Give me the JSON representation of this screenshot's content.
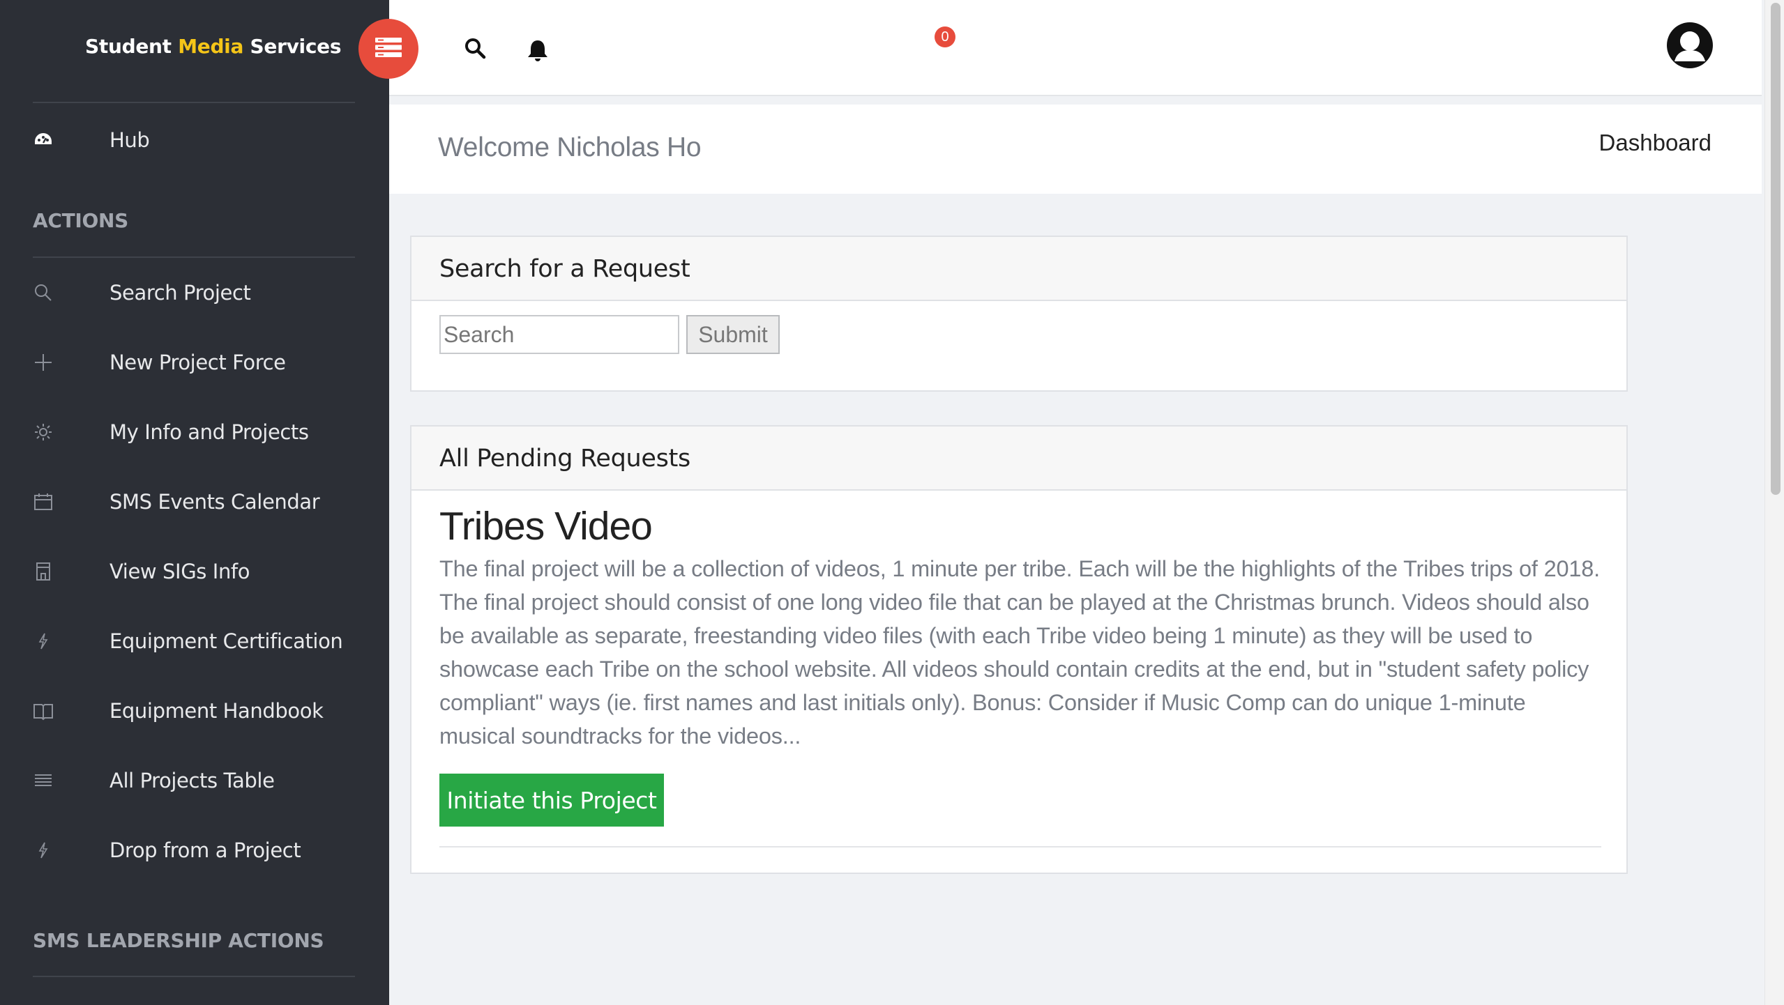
{
  "brand": {
    "part1": "Student ",
    "part2": "Media",
    "part3": " Services"
  },
  "sidebar": {
    "hub": {
      "label": "Hub",
      "icon": "dashboard-icon"
    },
    "actions_heading": "ACTIONS",
    "items": [
      {
        "label": "Search Project",
        "icon": "search-icon"
      },
      {
        "label": "New Project Force",
        "icon": "plus-icon"
      },
      {
        "label": "My Info and Projects",
        "icon": "sun-icon"
      },
      {
        "label": "SMS Events Calendar",
        "icon": "calendar-icon"
      },
      {
        "label": "View SIGs Info",
        "icon": "building-icon"
      },
      {
        "label": "Equipment Certification",
        "icon": "bolt-icon"
      },
      {
        "label": "Equipment Handbook",
        "icon": "book-icon"
      },
      {
        "label": "All Projects Table",
        "icon": "list-icon"
      },
      {
        "label": "Drop from a Project",
        "icon": "bolt-icon"
      }
    ],
    "leadership_heading": "SMS LEADERSHIP ACTIONS"
  },
  "topbar": {
    "notification_count": "0"
  },
  "header": {
    "welcome": "Welcome Nicholas Ho",
    "breadcrumb": "Dashboard"
  },
  "search_card": {
    "title": "Search for a Request",
    "placeholder": "Search",
    "submit_label": "Submit"
  },
  "pending_card": {
    "title": "All Pending Requests",
    "request": {
      "title": "Tribes Video",
      "description": "The final project will be a collection of videos, 1 minute per tribe. Each will be the highlights of the Tribes trips of 2018. The final project should consist of one long video file that can be played at the Christmas brunch. Videos should also be available as separate, freestanding video files (with each Tribe video being 1 minute) as they will be used to showcase each Tribe on the school website. All videos should contain credits at the end, but in \"student safety policy compliant\" ways (ie. first names and last initials only). Bonus: Consider if Music Comp can do unique 1-minute musical soundtracks for the videos...",
      "button_label": "Initiate this Project"
    }
  },
  "colors": {
    "sidebar_bg": "#2c2f36",
    "accent_red": "#e74c3c",
    "brand_yellow": "#f5c518",
    "success_green": "#28a745"
  }
}
